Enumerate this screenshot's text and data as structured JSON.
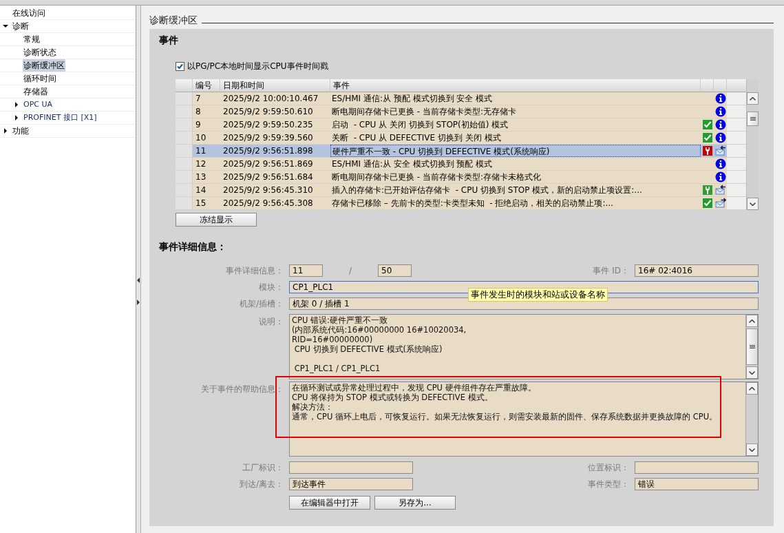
{
  "sidebar": {
    "items": [
      {
        "label": "在线访问",
        "kind": "page",
        "selected": false
      },
      {
        "label": "诊断",
        "kind": "group",
        "expanded": true,
        "selected": false,
        "children": [
          {
            "label": "常规",
            "kind": "page",
            "selected": false
          },
          {
            "label": "诊断状态",
            "kind": "page",
            "selected": false
          },
          {
            "label": "诊断缓冲区",
            "kind": "page",
            "selected": true
          },
          {
            "label": "循环时间",
            "kind": "page",
            "selected": false
          },
          {
            "label": "存储器",
            "kind": "page",
            "selected": false
          },
          {
            "label": "OPC UA",
            "kind": "group",
            "expanded": false,
            "selected": false
          },
          {
            "label": "PROFINET 接口 [X1]",
            "kind": "group",
            "expanded": false,
            "selected": false
          }
        ]
      },
      {
        "label": "功能",
        "kind": "group",
        "expanded": false,
        "selected": false
      }
    ]
  },
  "page_title": "诊断缓冲区",
  "events_section": {
    "title": "事件",
    "local_time_checkbox": {
      "label": "以PG/PC本地时间显示CPU事件时间戳",
      "checked": true
    },
    "table": {
      "columns": [
        "编号",
        "日期和时间",
        "事件"
      ],
      "rows": [
        {
          "number": "7",
          "datetime": "2025/9/2 10:00:10.467",
          "event": "ES/HMI 通信:从 预配 模式切换到 安全 模式",
          "type_icon": {
            "kind": "info"
          },
          "selected": false
        },
        {
          "number": "8",
          "datetime": "2025/9/2 9:59:50.610",
          "event": "断电期间存储卡已更换 - 当前存储卡类型:无存储卡",
          "type_icon": {
            "kind": "info"
          },
          "selected": false
        },
        {
          "number": "9",
          "datetime": "2025/9/2 9:59:50.235",
          "event": "启动  - CPU 从 关闭 切换到 STOP(初始值) 模式",
          "status_icon": {
            "kind": "ok"
          },
          "type_icon": {
            "kind": "info"
          },
          "selected": false
        },
        {
          "number": "10",
          "datetime": "2025/9/2 9:59:39.560",
          "event": "关断  - CPU 从 DEFECTIVE 切换到 关闭 模式",
          "status_icon": {
            "kind": "ok"
          },
          "type_icon": {
            "kind": "info"
          },
          "selected": false
        },
        {
          "number": "11",
          "datetime": "2025/9/2 9:56:51.898",
          "event": "硬件严重不一致 - CPU 切换到 DEFECTIVE 模式(系统响应)",
          "status_icon": {
            "kind": "error"
          },
          "type_icon": {
            "kind": "incoming"
          },
          "selected": true
        },
        {
          "number": "12",
          "datetime": "2025/9/2 9:56:51.869",
          "event": "ES/HMI 通信:从 安全 模式切换到 预配 模式",
          "type_icon": {
            "kind": "info"
          },
          "selected": false
        },
        {
          "number": "13",
          "datetime": "2025/9/2 9:56:51.684",
          "event": "断电期间存储卡已更换 - 当前存储卡类型:存储卡未格式化",
          "type_icon": {
            "kind": "info"
          },
          "selected": false
        },
        {
          "number": "14",
          "datetime": "2025/9/2 9:56:45.310",
          "event": "插入的存储卡:已开始评估存储卡  - CPU 切换到 STOP 模式，新的启动禁止项设置:...",
          "status_icon": {
            "kind": "maintenance"
          },
          "type_icon": {
            "kind": "incoming"
          },
          "selected": false
        },
        {
          "number": "15",
          "datetime": "2025/9/2 9:56:45.308",
          "event": "存储卡已移除 – 先前卡的类型:卡类型未知  - 拒绝启动，相关的启动禁止项:...",
          "status_icon": {
            "kind": "ok"
          },
          "type_icon": {
            "kind": "outgoing"
          },
          "selected": false
        }
      ]
    },
    "freeze_button": "冻结显示"
  },
  "details": {
    "title": "事件详细信息：",
    "event_detail_label": "事件详细信息：",
    "event_index": "11",
    "separator": "/",
    "event_total": "50",
    "event_id_label": "事件 ID：",
    "event_id": "16# 02:4016",
    "module_label": "模块：",
    "module": "CP1_PLC1",
    "module_focused": true,
    "tooltip": "事件发生时的模块和站或设备名称",
    "rack_slot_label": "机架/插槽：",
    "rack_slot": "机架 0 / 插槽 1",
    "description_label": "说明：",
    "description_paragraphs": [
      [
        "CPU 错误:硬件严重不一致",
        "(内部系统代码:16#00000000 16#10020034,",
        "RID=16#00000000)",
        " CPU 切换到 DEFECTIVE 模式(系统响应)"
      ],
      [
        " CP1_PLC1 / CP1_PLC1"
      ]
    ],
    "help_label": "关于事件的帮助信息：",
    "help_paragraphs": [
      [
        "在循环测试或异常处理过程中，发现 CPU 硬件组件存在严重故障。",
        "CPU 将保持为 STOP 模式或转换为 DEFECTIVE 模式。",
        "解决方法：",
        "通常，CPU 循环上电后，可恢复运行。如果无法恢复运行，则需安装最新的固件、保存系统数据并更换故障的 CPU。"
      ]
    ],
    "help_highlighted": true,
    "plant_id_label": "工厂标识：",
    "location_id_label": "位置标识：",
    "arrival_label": "到达/离去：",
    "arrival": "到达事件",
    "event_type_label": "事件类型：",
    "event_type": "错误",
    "buttons": [
      "在编辑器中打开",
      "另存为..."
    ]
  }
}
